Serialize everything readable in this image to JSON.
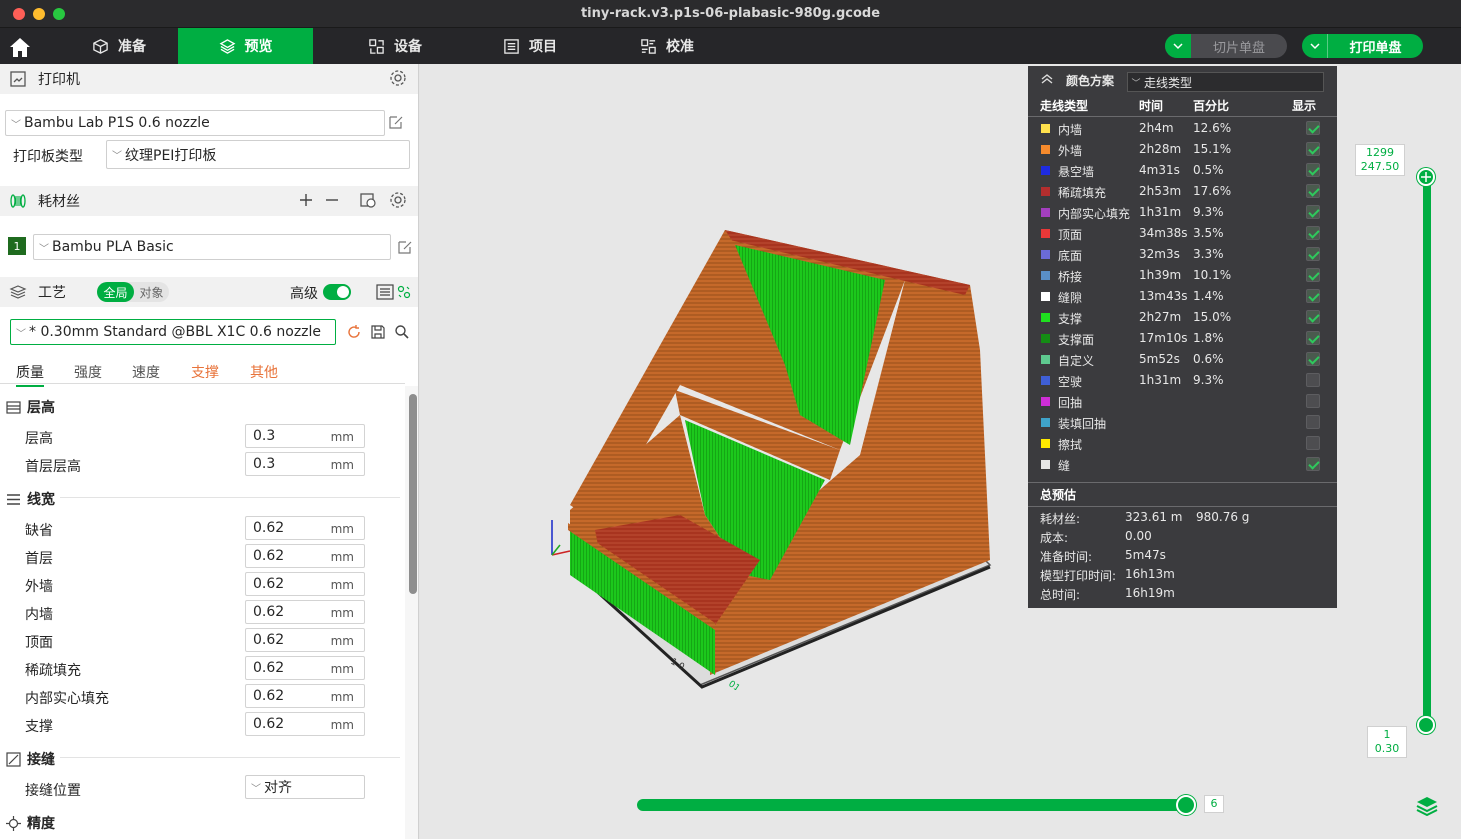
{
  "window": {
    "title": "tiny-rack.v3.p1s-06-plabasic-980g.gcode"
  },
  "nav": {
    "tabs": [
      {
        "label": "准备",
        "icon": "cube-icon"
      },
      {
        "label": "预览",
        "icon": "layers-icon",
        "active": true
      },
      {
        "label": "设备",
        "icon": "device-icon"
      },
      {
        "label": "项目",
        "icon": "project-icon"
      },
      {
        "label": "校准",
        "icon": "calibrate-icon"
      }
    ],
    "slice_button": "切片单盘",
    "print_button": "打印单盘"
  },
  "printer": {
    "section_title": "打印机",
    "model": "Bambu Lab P1S 0.6 nozzle",
    "plate_label": "打印板类型",
    "plate_value": "纹理PEI打印板"
  },
  "filament": {
    "section_title": "耗材丝",
    "slot": "1",
    "name": "Bambu PLA Basic",
    "slot_color": "#1f6b1f"
  },
  "process": {
    "section_title": "工艺",
    "scope_global": "全局",
    "scope_object": "对象",
    "advanced_label": "高级",
    "preset": "* 0.30mm Standard @BBL X1C 0.6 nozzle",
    "tabs": [
      "质量",
      "强度",
      "速度",
      "支撑",
      "其他"
    ],
    "groups": {
      "layer_height": {
        "title": "层高",
        "rows": [
          {
            "label": "层高",
            "value": "0.3",
            "unit": "mm"
          },
          {
            "label": "首层层高",
            "value": "0.3",
            "unit": "mm"
          }
        ]
      },
      "line_width": {
        "title": "线宽",
        "rows": [
          {
            "label": "缺省",
            "value": "0.62",
            "unit": "mm"
          },
          {
            "label": "首层",
            "value": "0.62",
            "unit": "mm"
          },
          {
            "label": "外墙",
            "value": "0.62",
            "unit": "mm"
          },
          {
            "label": "内墙",
            "value": "0.62",
            "unit": "mm"
          },
          {
            "label": "顶面",
            "value": "0.62",
            "unit": "mm"
          },
          {
            "label": "稀疏填充",
            "value": "0.62",
            "unit": "mm"
          },
          {
            "label": "内部实心填充",
            "value": "0.62",
            "unit": "mm"
          },
          {
            "label": "支撑",
            "value": "0.62",
            "unit": "mm"
          }
        ]
      },
      "seam": {
        "title": "接缝",
        "rows": [
          {
            "label": "接缝位置",
            "value": "对齐"
          }
        ]
      },
      "precision": {
        "title": "精度"
      }
    }
  },
  "legend": {
    "title": "颜色方案",
    "scheme": "走线类型",
    "columns": [
      "走线类型",
      "时间",
      "百分比",
      "显示"
    ],
    "rows": [
      {
        "name": "内墙",
        "time": "2h4m",
        "percent": "12.6%",
        "color": "#ffe14d",
        "shown": true
      },
      {
        "name": "外墙",
        "time": "2h28m",
        "percent": "15.1%",
        "color": "#f58a2c",
        "shown": true
      },
      {
        "name": "悬空墙",
        "time": "4m31s",
        "percent": "0.5%",
        "color": "#1e2be0",
        "shown": true
      },
      {
        "name": "稀疏填充",
        "time": "2h53m",
        "percent": "17.6%",
        "color": "#b32e2e",
        "shown": true
      },
      {
        "name": "内部实心填充",
        "time": "1h31m",
        "percent": "9.3%",
        "color": "#a33fbf",
        "shown": true
      },
      {
        "name": "顶面",
        "time": "34m38s",
        "percent": "3.5%",
        "color": "#e83838",
        "shown": true
      },
      {
        "name": "底面",
        "time": "32m3s",
        "percent": "3.3%",
        "color": "#6b6bd6",
        "shown": true
      },
      {
        "name": "桥接",
        "time": "1h39m",
        "percent": "10.1%",
        "color": "#5a8fc7",
        "shown": true
      },
      {
        "name": "缝隙",
        "time": "13m43s",
        "percent": "1.4%",
        "color": "#ffffff",
        "shown": true
      },
      {
        "name": "支撑",
        "time": "2h27m",
        "percent": "15.0%",
        "color": "#1fe01f",
        "shown": true
      },
      {
        "name": "支撑面",
        "time": "17m10s",
        "percent": "1.8%",
        "color": "#148c14",
        "shown": true
      },
      {
        "name": "自定义",
        "time": "5m52s",
        "percent": "0.6%",
        "color": "#5ec98f",
        "shown": true
      },
      {
        "name": "空驶",
        "time": "1h31m",
        "percent": "9.3%",
        "color": "#3f5fd6",
        "shown": false
      },
      {
        "name": "回抽",
        "time": "",
        "percent": "",
        "color": "#cf2ed6",
        "shown": false
      },
      {
        "name": "装填回抽",
        "time": "",
        "percent": "",
        "color": "#3fa3c9",
        "shown": false
      },
      {
        "name": "擦拭",
        "time": "",
        "percent": "",
        "color": "#ffea00",
        "shown": false
      },
      {
        "name": "缝",
        "time": "",
        "percent": "",
        "color": "#e6e6e6",
        "shown": true
      }
    ],
    "summary": {
      "title": "总预估",
      "filament_label": "耗材丝:",
      "filament_length": "323.61 m",
      "filament_weight": "980.76 g",
      "cost_label": "成本:",
      "cost": "0.00",
      "prep_label": "准备时间:",
      "prep": "5m47s",
      "model_label": "模型打印时间:",
      "model": "16h13m",
      "total_label": "总时间:",
      "total": "16h19m"
    }
  },
  "layer_slider": {
    "top_layer": "1299",
    "top_height": "247.50",
    "bottom_layer": "1",
    "bottom_height": "0.30"
  },
  "move_slider": {
    "value": "6"
  }
}
